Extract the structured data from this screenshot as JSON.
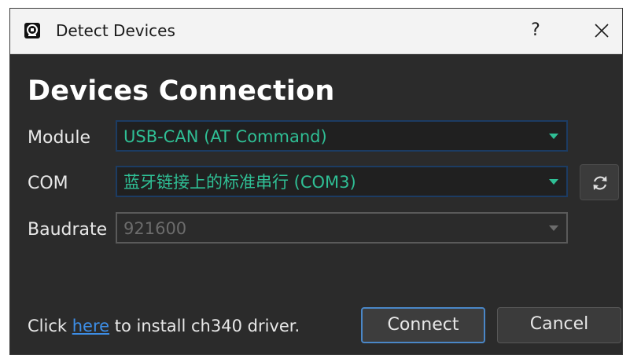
{
  "window": {
    "title": "Detect Devices",
    "help_label": "?"
  },
  "heading": "Devices Connection",
  "module": {
    "label": "Module",
    "selected": "USB-CAN (AT Command)"
  },
  "com": {
    "label": "COM",
    "selected": "蓝牙链接上的标准串行 (COM3)"
  },
  "baudrate": {
    "label": "Baudrate",
    "selected": "921600",
    "disabled": true
  },
  "footer": {
    "prefix": "Click ",
    "link": "here",
    "suffix": " to install ch340 driver."
  },
  "buttons": {
    "connect": "Connect",
    "cancel": "Cancel"
  },
  "colors": {
    "window_bg": "#2b2b2b",
    "accent_text": "#2fbf95",
    "link": "#3d8ee6",
    "focus_border": "#4a87c7"
  },
  "icons": {
    "app": "app-logo-icon",
    "close": "close-icon",
    "refresh": "refresh-icon",
    "dropdown": "chevron-down-icon"
  }
}
